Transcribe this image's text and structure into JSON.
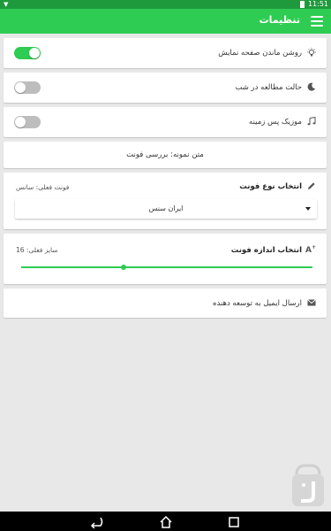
{
  "status_bar": {
    "time": "11:51"
  },
  "app_bar": {
    "title": "تنظیمات"
  },
  "settings": {
    "screen_on": {
      "label": "روشن ماندن صفحه نمایش",
      "enabled": true
    },
    "night_mode": {
      "label": "حالت مطالعه در شب",
      "enabled": false
    },
    "background_music": {
      "label": "موزیک پس زمینه",
      "enabled": false
    }
  },
  "sample_text": "متن نمونه: بررسی فونت",
  "font_type": {
    "title": "انتخاب نوع فونت",
    "current": "فونت فعلی: سانس",
    "selected_option": "ایران سنس"
  },
  "font_size": {
    "title": "انتخاب اندازه فونت",
    "current": "سایز فعلی: 16",
    "slider_fraction": 0.35
  },
  "email": {
    "label": "ارسال ایمیل به توسعه دهنده"
  },
  "colors": {
    "accent": "#2ecc52",
    "status": "#1e9a3c"
  }
}
